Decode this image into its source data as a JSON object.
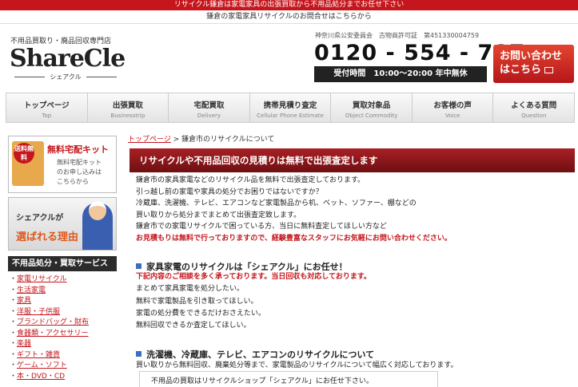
{
  "topbar": {
    "text": "リサイクル鎌倉は家電家具の出張買取から不用品処分までお任せ下さい"
  },
  "subbar": {
    "text": "鎌倉の家電家具リサイクルのお問合せはこちらから"
  },
  "header": {
    "tagline": "不用品買取り・廃品回収専門店",
    "logo": "ShareCle",
    "logo_kana": "シェアクル",
    "license": "神奈川県公安委員会　古物商許可証　第451330004759",
    "phone": "0120 - 554 - 717",
    "hours": "受付時間　10:00～20:00 年中無休",
    "contact_line1": "お問い合わせ",
    "contact_line2": "はこちら"
  },
  "nav": [
    {
      "label": "トップページ",
      "sub": "Top"
    },
    {
      "label": "出張買取",
      "sub": "Businesstrip"
    },
    {
      "label": "宅配買取",
      "sub": "Delivery"
    },
    {
      "label": "携帯見積り査定",
      "sub": "Cellular Phone Estimate"
    },
    {
      "label": "買取対象品",
      "sub": "Object Commodity"
    },
    {
      "label": "お客様の声",
      "sub": "Voice"
    },
    {
      "label": "よくある質問",
      "sub": "Question"
    }
  ],
  "sidebar": {
    "kit_tag": "送料無料",
    "kit_title": "無料宅配キット",
    "kit_line1": "無料宅配キット",
    "kit_line2": "のお申し込みは",
    "kit_line3": "こちらから",
    "reason_line1": "シェアクルが",
    "reason_line2": "選ばれる理由",
    "service_title": "不用品処分・買取サービス",
    "items": [
      "家電リサイクル",
      "生活家電",
      "家具",
      "洋服・子供服",
      "ブランドバッグ・財布",
      "食器類・アクセサリー",
      "楽器",
      "ギフト・雑貨",
      "ゲーム・ソフト",
      "本・DVD・CD"
    ]
  },
  "main": {
    "crumb_home": "トップページ",
    "crumb_sep": " > ",
    "crumb_current": "鎌倉市のリサイクルについて",
    "title": "リサイクルや不用品回収の見積りは無料で出張査定します",
    "intro": [
      "鎌倉市の家具家電などのリサイクル品を無料で出張査定しております。",
      "引っ越し前の家電や家具の処分でお困りではないですか？",
      "冷蔵庫、洗濯機、テレビ、エアコンなど家電製品から机、ベット、ソファー、棚などの",
      "買い取りから処分までまとめて出張査定致します。",
      "鎌倉市での家電リサイクルで困っている方、当日に無料査定してほしい方など"
    ],
    "intro_red": "お見積もりは無料で行っておりますので、経験豊富なスタッフにお気軽にお問い合わせください。",
    "sec1_title": "家具家電のリサイクルは「シェアクル」にお任せ！",
    "sec1_red": "下記内容のご相談を多く承っております。当日回収も対応しております。",
    "sec1_items": [
      "まとめて家具家電を処分したい。",
      "無料で家電製品を引き取ってほしい。",
      "家電の処分費をできるだけおさえたい。",
      "無料回収できるか査定してほしい。"
    ],
    "sec2_title": "洗濯機、冷蔵庫、テレビ、エアコンのリサイクルについて",
    "sec2_text": "買い取りから無料回収、廃棄処分等まで、家電製品のリサイクルについて幅広く対応しております。",
    "sec2_box": "不用品の買取はリサイクルショップ「シェアクル」にお任せ下さい。"
  }
}
